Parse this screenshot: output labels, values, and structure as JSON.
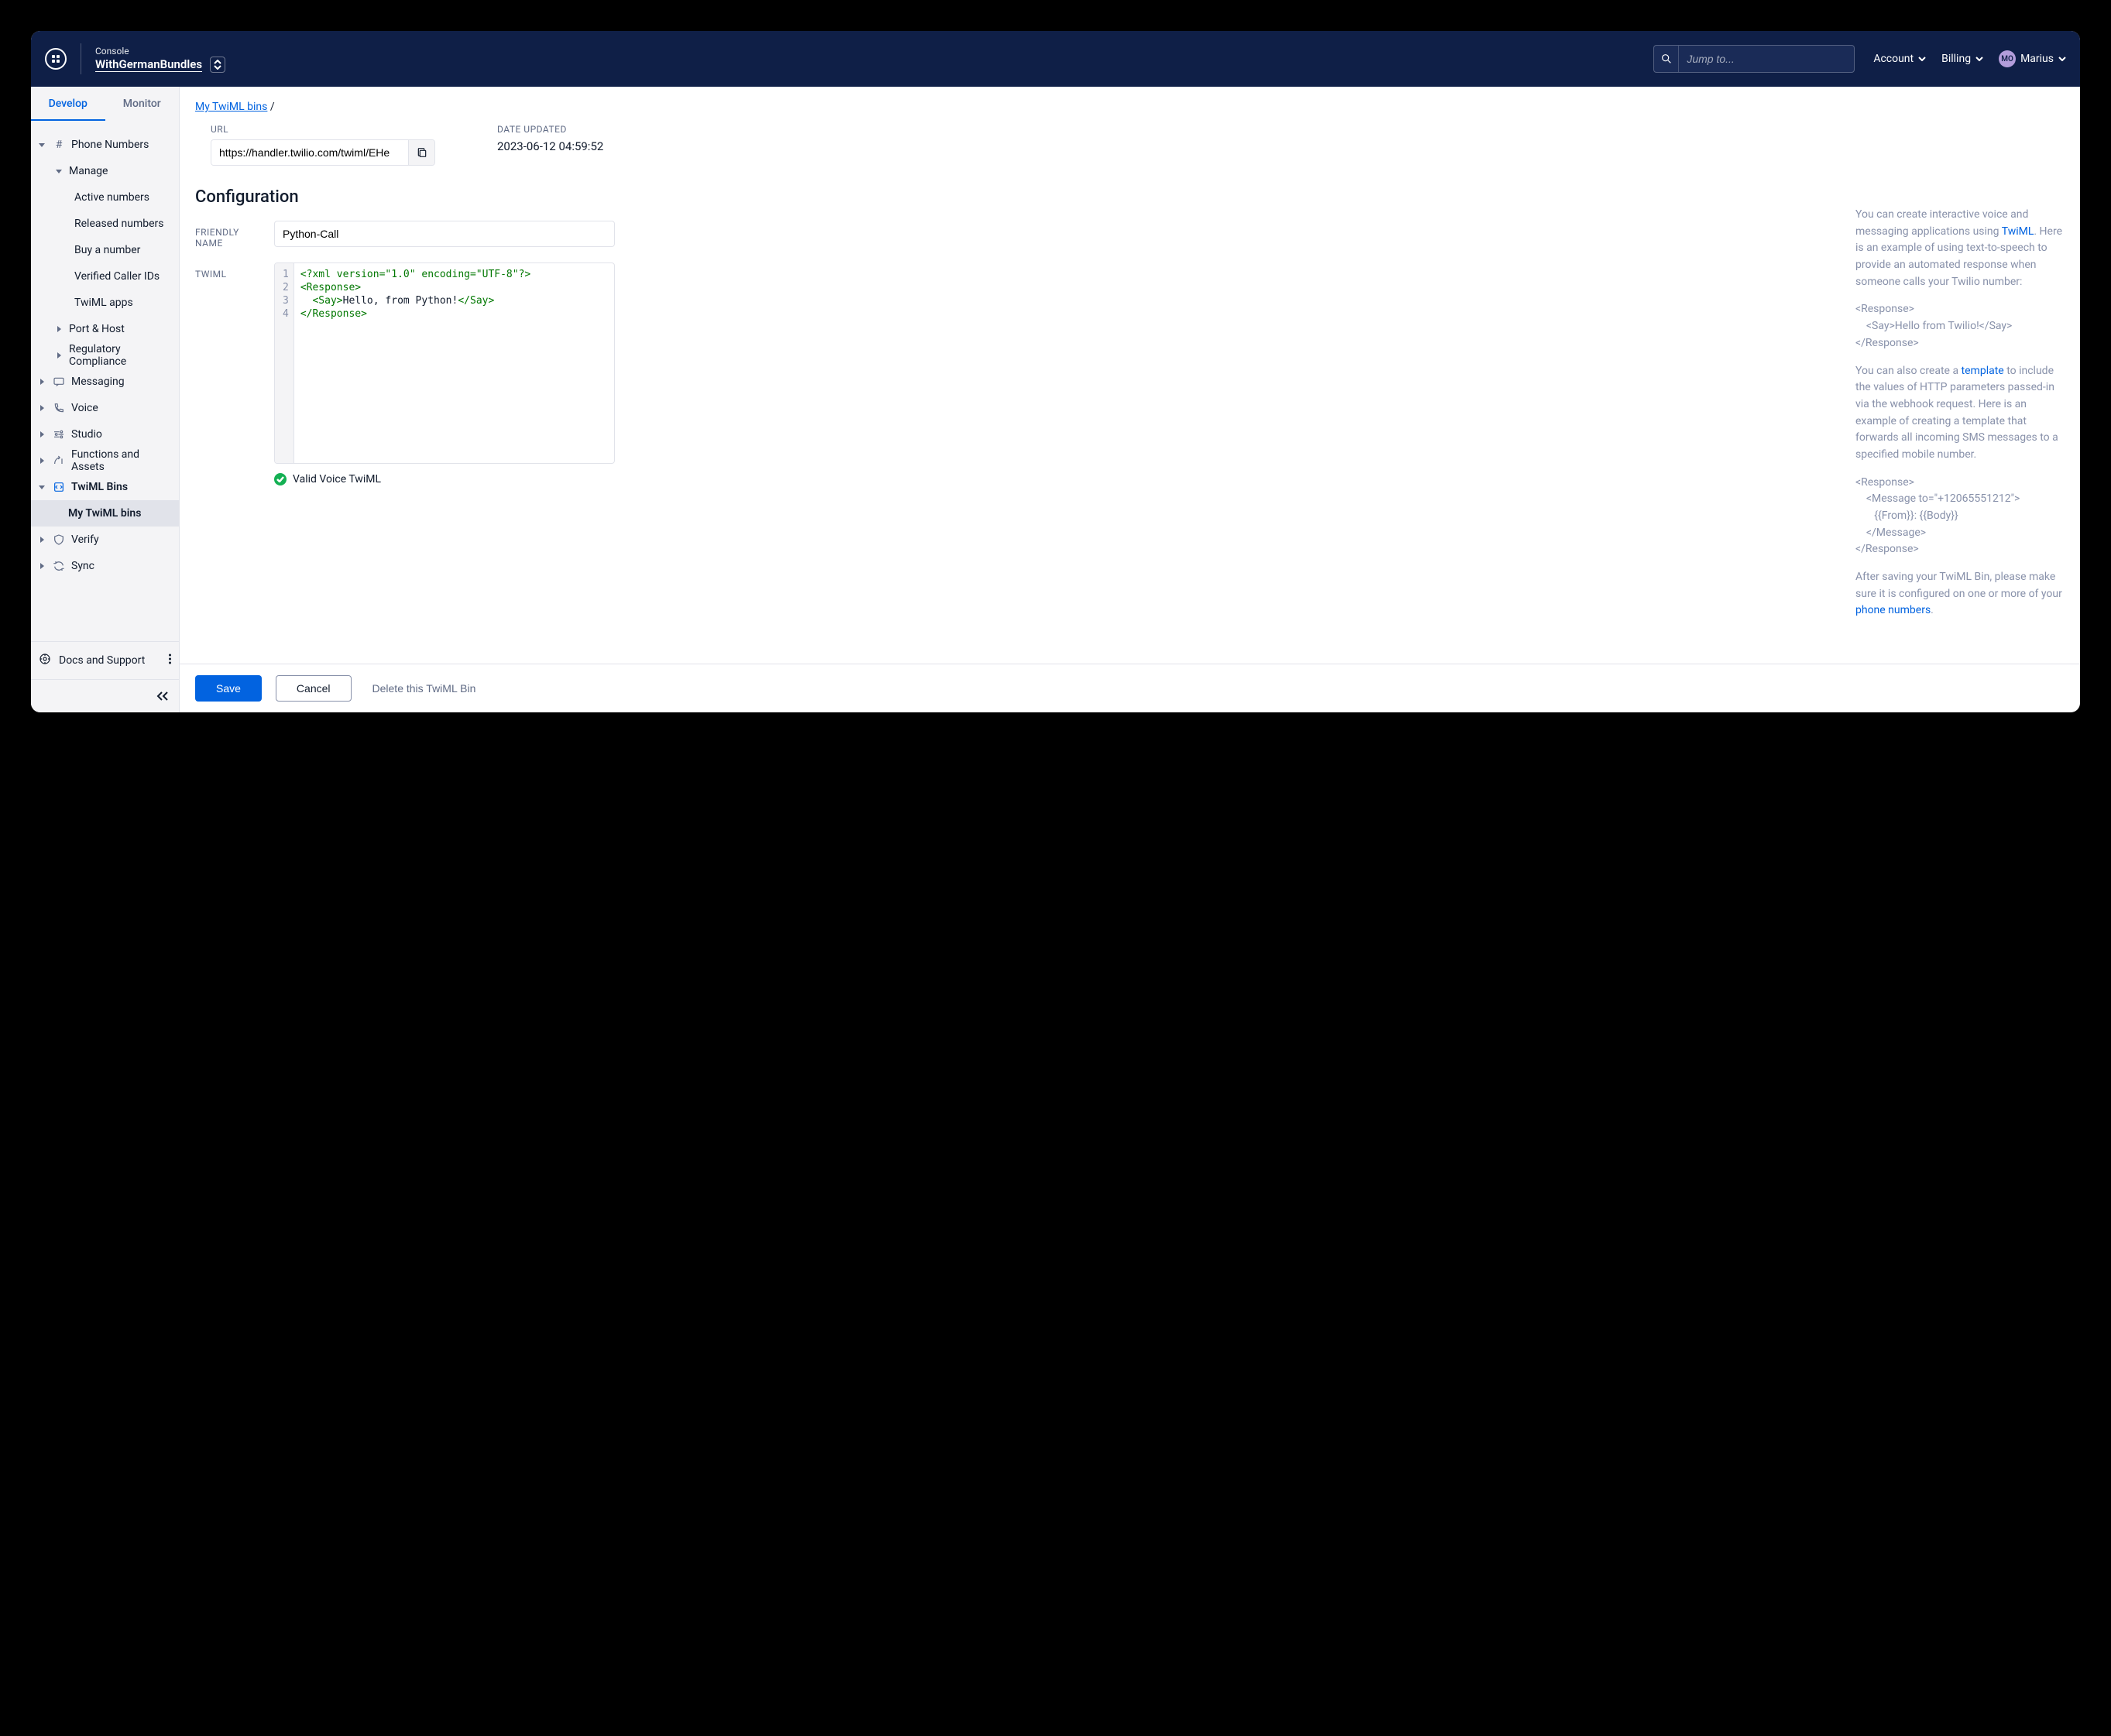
{
  "header": {
    "console_label": "Console",
    "project_name": "WithGermanBundles",
    "search_placeholder": "Jump to...",
    "account_label": "Account",
    "billing_label": "Billing",
    "user_initials": "MO",
    "user_name": "Marius"
  },
  "sidebar": {
    "tab_develop": "Develop",
    "tab_monitor": "Monitor",
    "phone_numbers": "Phone Numbers",
    "manage": "Manage",
    "active_numbers": "Active numbers",
    "released_numbers": "Released numbers",
    "buy_a_number": "Buy a number",
    "verified_caller_ids": "Verified Caller IDs",
    "twiml_apps": "TwiML apps",
    "port_host": "Port & Host",
    "regulatory_compliance": "Regulatory Compliance",
    "messaging": "Messaging",
    "voice": "Voice",
    "studio": "Studio",
    "functions_assets": "Functions and Assets",
    "twiml_bins": "TwiML Bins",
    "my_twiml_bins": "My TwiML bins",
    "verify": "Verify",
    "sync": "Sync",
    "docs_support": "Docs and Support"
  },
  "crumb": {
    "link": "My TwiML bins",
    "sep": "/"
  },
  "meta": {
    "url_label": "URL",
    "url_value": "https://handler.twilio.com/twiml/EHe",
    "date_label": "DATE UPDATED",
    "date_value": "2023-06-12 04:59:52"
  },
  "config": {
    "title": "Configuration",
    "friendly_label": "FRIENDLY NAME",
    "friendly_value": "Python-Call",
    "twiml_label": "TWIML",
    "gutter": [
      "1",
      "2",
      "3",
      "4"
    ],
    "line1": "<?xml version=\"1.0\" encoding=\"UTF-8\"?>",
    "line2_open": "<Response>",
    "line3_open": "<Say>",
    "line3_text": "Hello, from Python!",
    "line3_close": "</Say>",
    "line4_close": "</Response>",
    "valid_label": "Valid Voice TwiML"
  },
  "help": {
    "p1a": "You can create interactive voice and messaging applications using ",
    "p1_link1": "TwiML",
    "p1b": ". Here is an example of using text-to-speech to provide an automated response when someone calls your Twilio number:",
    "ex1_l1": "<Response>",
    "ex1_l2": "    <Say>Hello from Twilio!</Say>",
    "ex1_l3": "</Response>",
    "p2a": "You can also create a ",
    "p2_link": "template",
    "p2b": " to include the values of HTTP parameters passed-in via the webhook request. Here is an example of creating a template that forwards all incoming SMS messages to a specified mobile number.",
    "ex2_l1": "<Response>",
    "ex2_l2": "    <Message to=\"+12065551212\">",
    "ex2_l3": "       {{From}}: {{Body}}",
    "ex2_l4": "    </Message>",
    "ex2_l5": "</Response>",
    "p3a": "After saving your TwiML Bin, please make sure it is configured on one or more of your ",
    "p3_link": "phone numbers",
    "p3b": "."
  },
  "actions": {
    "save": "Save",
    "cancel": "Cancel",
    "delete": "Delete this TwiML Bin"
  }
}
